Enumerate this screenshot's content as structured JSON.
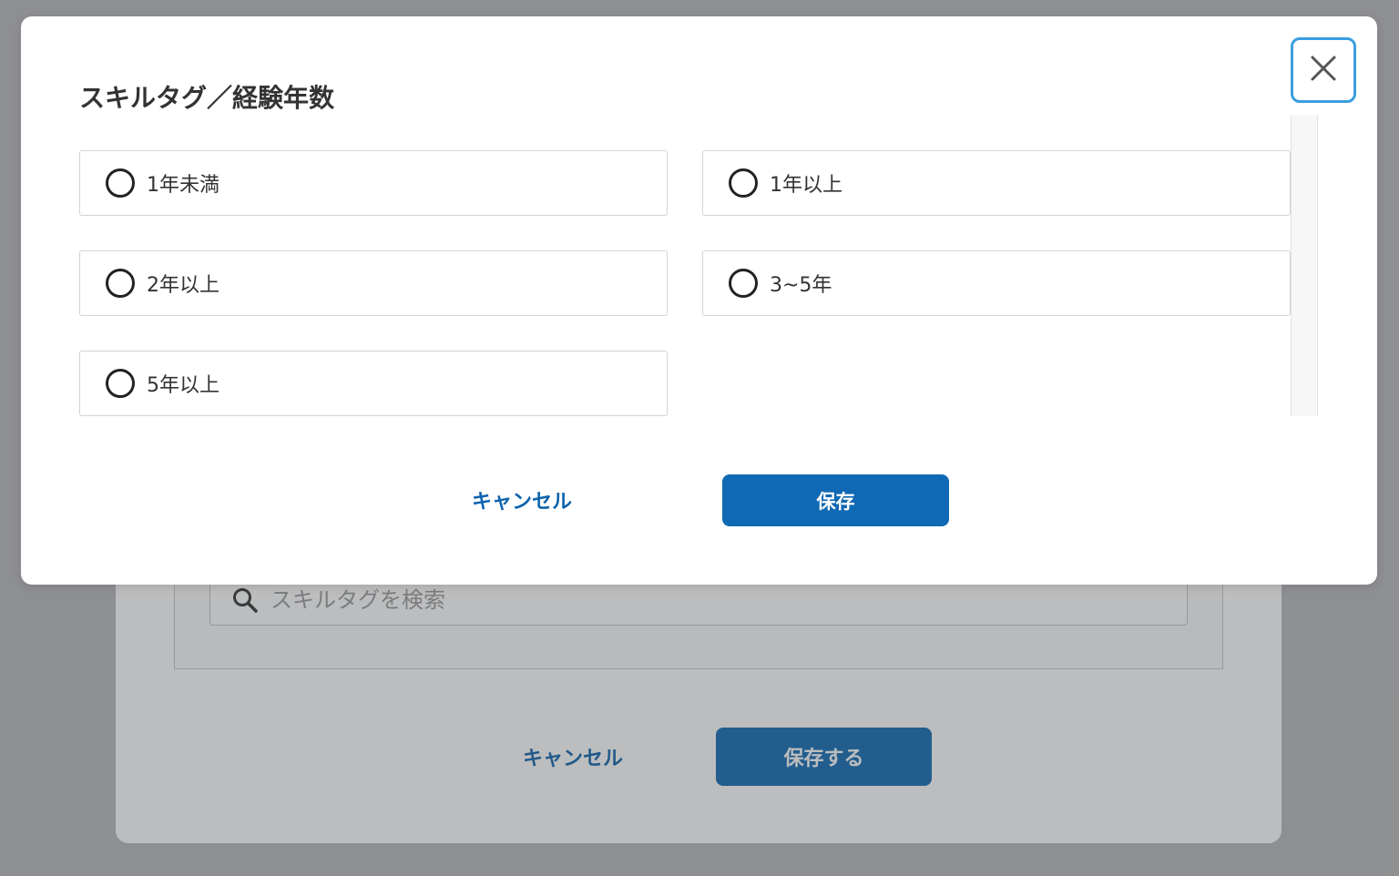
{
  "background": {
    "search": {
      "placeholder": "スキルタグを検索"
    },
    "cancel_label": "キャンセル",
    "save_label": "保存する"
  },
  "modal": {
    "title": "スキルタグ／経験年数",
    "options": [
      {
        "label": "1年未満",
        "selected": false
      },
      {
        "label": "1年以上",
        "selected": false
      },
      {
        "label": "2年以上",
        "selected": false
      },
      {
        "label": "3~5年",
        "selected": false
      },
      {
        "label": "5年以上",
        "selected": false
      }
    ],
    "cancel_label": "キャンセル",
    "save_label": "保存"
  },
  "colors": {
    "primary": "#0f69b4",
    "link": "#0d63ad",
    "focus_ring": "#3a9ee0"
  },
  "icons": {
    "close": "close-icon",
    "search": "search-icon",
    "radio": "radio-unchecked-icon"
  }
}
